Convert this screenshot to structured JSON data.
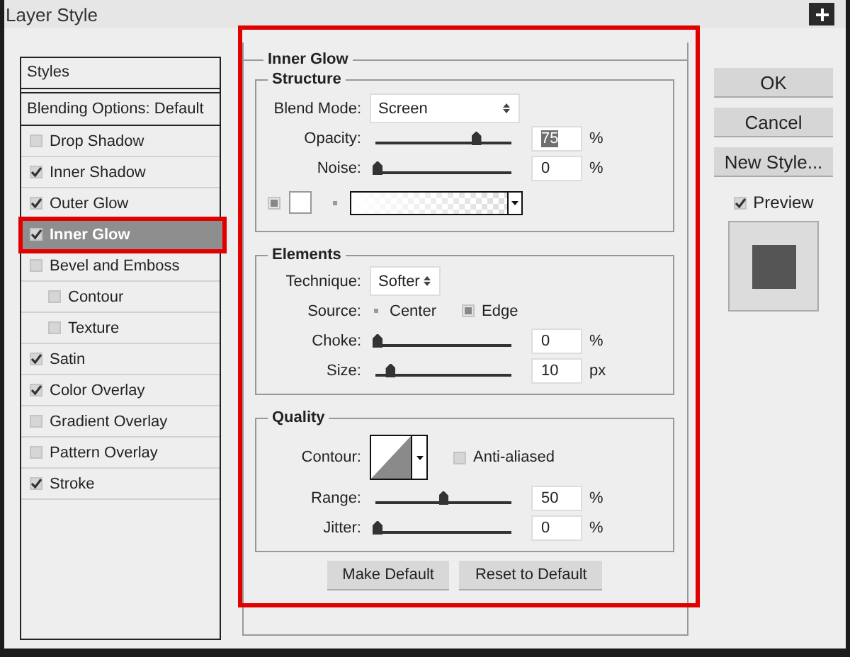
{
  "window": {
    "title": "Layer Style"
  },
  "styles_list": {
    "header": "Styles",
    "blending_options": "Blending Options: Default",
    "items": [
      {
        "label": "Drop Shadow",
        "checked": false,
        "selected": false,
        "highlighted": false
      },
      {
        "label": "Inner Shadow",
        "checked": true,
        "selected": false,
        "highlighted": false
      },
      {
        "label": "Outer Glow",
        "checked": true,
        "selected": false,
        "highlighted": false
      },
      {
        "label": "Inner Glow",
        "checked": true,
        "selected": true,
        "highlighted": true
      },
      {
        "label": "Bevel and Emboss",
        "checked": false,
        "selected": false,
        "highlighted": false,
        "children": [
          {
            "label": "Contour",
            "checked": false,
            "selected": false,
            "highlighted": false
          },
          {
            "label": "Texture",
            "checked": false,
            "selected": false,
            "highlighted": false
          }
        ]
      },
      {
        "label": "Satin",
        "checked": true,
        "selected": false,
        "highlighted": false
      },
      {
        "label": "Color Overlay",
        "checked": true,
        "selected": false,
        "highlighted": false
      },
      {
        "label": "Gradient Overlay",
        "checked": false,
        "selected": false,
        "highlighted": false
      },
      {
        "label": "Pattern Overlay",
        "checked": false,
        "selected": false,
        "highlighted": false
      },
      {
        "label": "Stroke",
        "checked": true,
        "selected": false,
        "highlighted": false
      }
    ]
  },
  "effect_panel": {
    "title": "Inner Glow",
    "highlighted": true,
    "structure": {
      "title": "Structure",
      "blend_mode": {
        "label": "Blend Mode:",
        "value": "Screen"
      },
      "sliders": [
        {
          "label": "Opacity:",
          "level": 0.75,
          "value": "75",
          "unit": "%",
          "text_selected": true
        },
        {
          "label": "Noise:",
          "level": 0,
          "value": "0",
          "unit": "%",
          "text_selected": false
        }
      ],
      "fill_options": [
        {
          "kind": "color",
          "selected": true
        },
        {
          "kind": "gradient",
          "selected": false
        }
      ]
    },
    "elements": {
      "title": "Elements",
      "technique": {
        "label": "Technique:",
        "value": "Softer"
      },
      "source": {
        "label": "Source:",
        "options": [
          {
            "label": "Center",
            "selected": false
          },
          {
            "label": "Edge",
            "selected": true
          }
        ]
      },
      "sliders": [
        {
          "label": "Choke:",
          "level": 0,
          "value": "0",
          "unit": "%",
          "text_selected": false
        },
        {
          "label": "Size:",
          "level": 0.1,
          "value": "10",
          "unit": "px",
          "text_selected": false
        }
      ]
    },
    "quality": {
      "title": "Quality",
      "contour": {
        "label": "Contour:"
      },
      "anti_aliased": {
        "label": "Anti-aliased",
        "checked": false
      },
      "sliders": [
        {
          "label": "Range:",
          "level": 0.5,
          "value": "50",
          "unit": "%",
          "text_selected": false
        },
        {
          "label": "Jitter:",
          "level": 0,
          "value": "0",
          "unit": "%",
          "text_selected": false
        }
      ]
    },
    "buttons": [
      "Make Default",
      "Reset to Default"
    ]
  },
  "side": {
    "buttons": [
      "OK",
      "Cancel",
      "New Style..."
    ],
    "preview": {
      "label": "Preview",
      "checked": true
    }
  }
}
